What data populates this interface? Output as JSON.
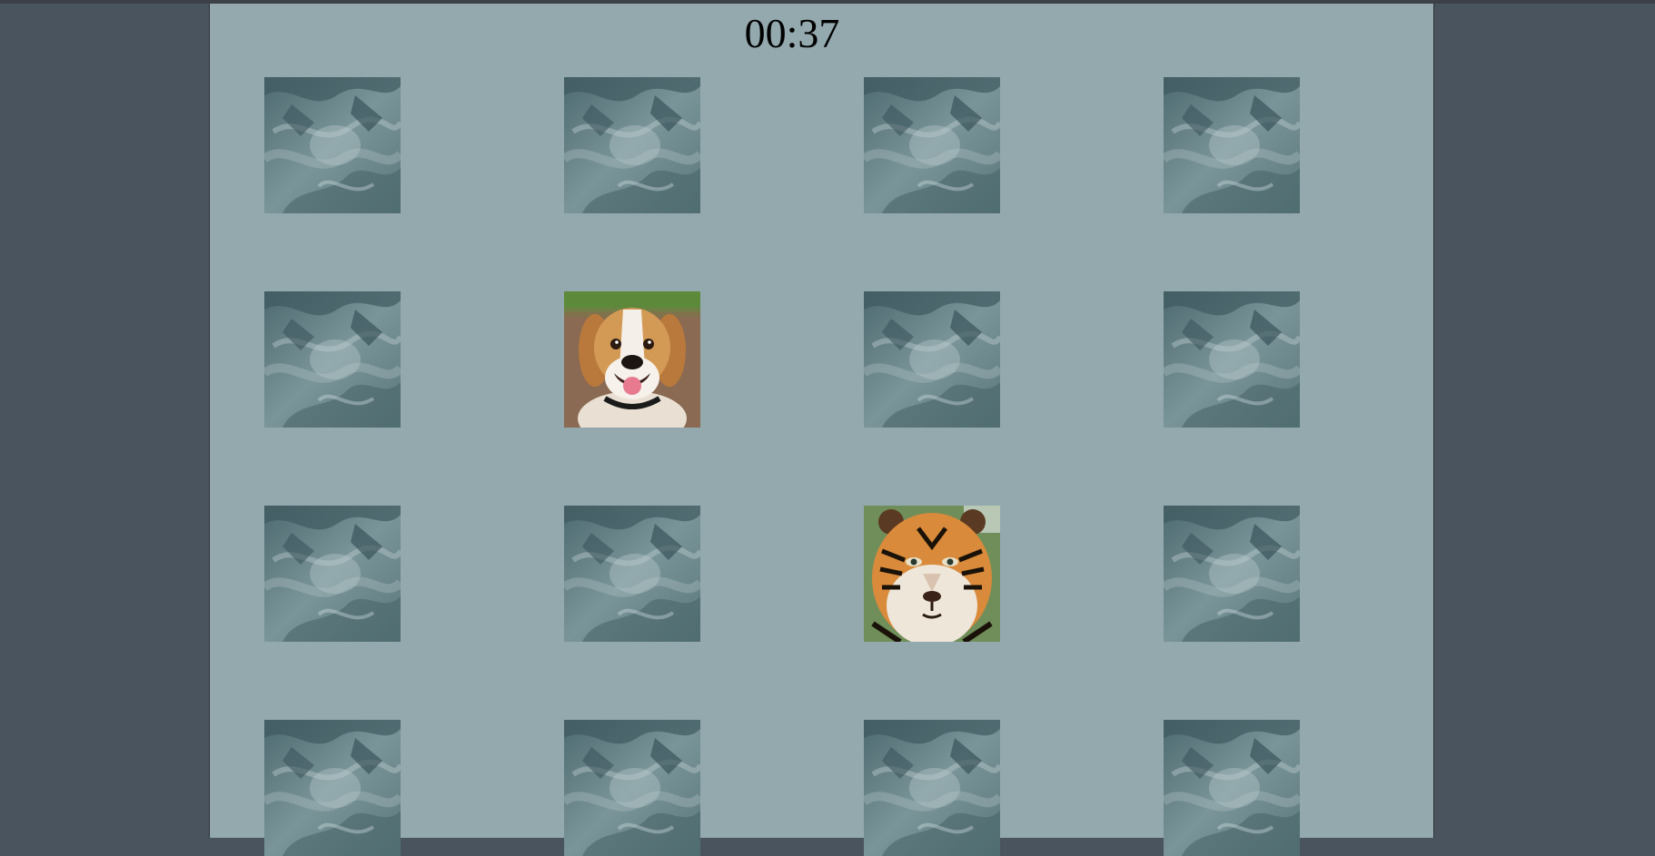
{
  "timer": "00:37",
  "colors": {
    "page_bg": "#4a545e",
    "board_bg": "#93a9ae",
    "card_back": "#5e7b80"
  },
  "cards": [
    {
      "state": "face-down",
      "image": null
    },
    {
      "state": "face-down",
      "image": null
    },
    {
      "state": "face-down",
      "image": null
    },
    {
      "state": "face-down",
      "image": null
    },
    {
      "state": "face-down",
      "image": null
    },
    {
      "state": "face-up",
      "image": "dog-beagle"
    },
    {
      "state": "face-down",
      "image": null
    },
    {
      "state": "face-down",
      "image": null
    },
    {
      "state": "face-down",
      "image": null
    },
    {
      "state": "face-down",
      "image": null
    },
    {
      "state": "face-up",
      "image": "tiger"
    },
    {
      "state": "face-down",
      "image": null
    },
    {
      "state": "face-down",
      "image": null
    },
    {
      "state": "face-down",
      "image": null
    },
    {
      "state": "face-down",
      "image": null
    },
    {
      "state": "face-down",
      "image": null
    }
  ]
}
